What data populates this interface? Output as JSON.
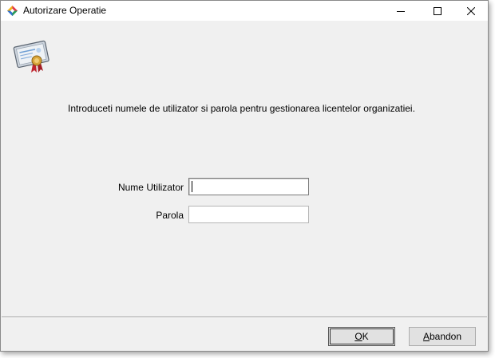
{
  "window": {
    "title": "Autorizare Operatie"
  },
  "content": {
    "instructions": "Introduceti numele de utilizator si parola pentru gestionarea licentelor organizatiei.",
    "username_label": "Nume Utilizator",
    "username_value": "",
    "password_label": "Parola",
    "password_value": ""
  },
  "buttons": {
    "ok_mnemonic": "O",
    "ok_rest": "K",
    "cancel_mnemonic": "A",
    "cancel_rest": "bandon"
  },
  "icons": {
    "app": "app-logo-icon",
    "certificate": "certificate-icon",
    "minimize": "minimize-icon",
    "maximize": "maximize-icon",
    "close": "close-icon"
  },
  "colors": {
    "dialog_background": "#f0f0f0",
    "button_face": "#e1e1e1"
  }
}
